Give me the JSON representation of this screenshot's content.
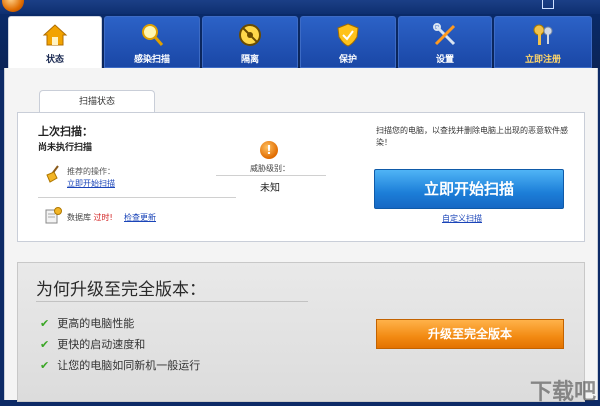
{
  "tabs": [
    {
      "label": "状态",
      "icon": "home-icon"
    },
    {
      "label": "感染扫描",
      "icon": "magnifier-icon"
    },
    {
      "label": "隔离",
      "icon": "quarantine-icon"
    },
    {
      "label": "保护",
      "icon": "shield-icon"
    },
    {
      "label": "设置",
      "icon": "tools-icon"
    },
    {
      "label": "立即注册",
      "icon": "keys-icon"
    }
  ],
  "panel_tab": "扫描状态",
  "last_scan": {
    "title": "上次扫描：",
    "value": "尚未执行扫描"
  },
  "recommend": {
    "label": "推荐的操作：",
    "link": "立即开始扫描"
  },
  "database": {
    "label_prefix": "数据库",
    "label_status": "过时!",
    "link": "检查更新"
  },
  "threat": {
    "label": "威胁级别：",
    "value": "未知"
  },
  "scan_desc": "扫描您的电脑，以查找并删除电脑上出现的恶意软件感染！",
  "scan_button": "立即开始扫描",
  "custom_scan": "自定义扫描",
  "upgrade": {
    "title": "为何升级至完全版本：",
    "benefits": [
      "更高的电脑性能",
      "更快的启动速度和",
      "让您的电脑如同新机一般运行"
    ],
    "button": "升级至完全版本"
  },
  "watermark": "下载吧",
  "colors": {
    "accent_blue": "#1c7ed8",
    "accent_orange": "#f28a12",
    "warning_red": "#d21e1e"
  }
}
